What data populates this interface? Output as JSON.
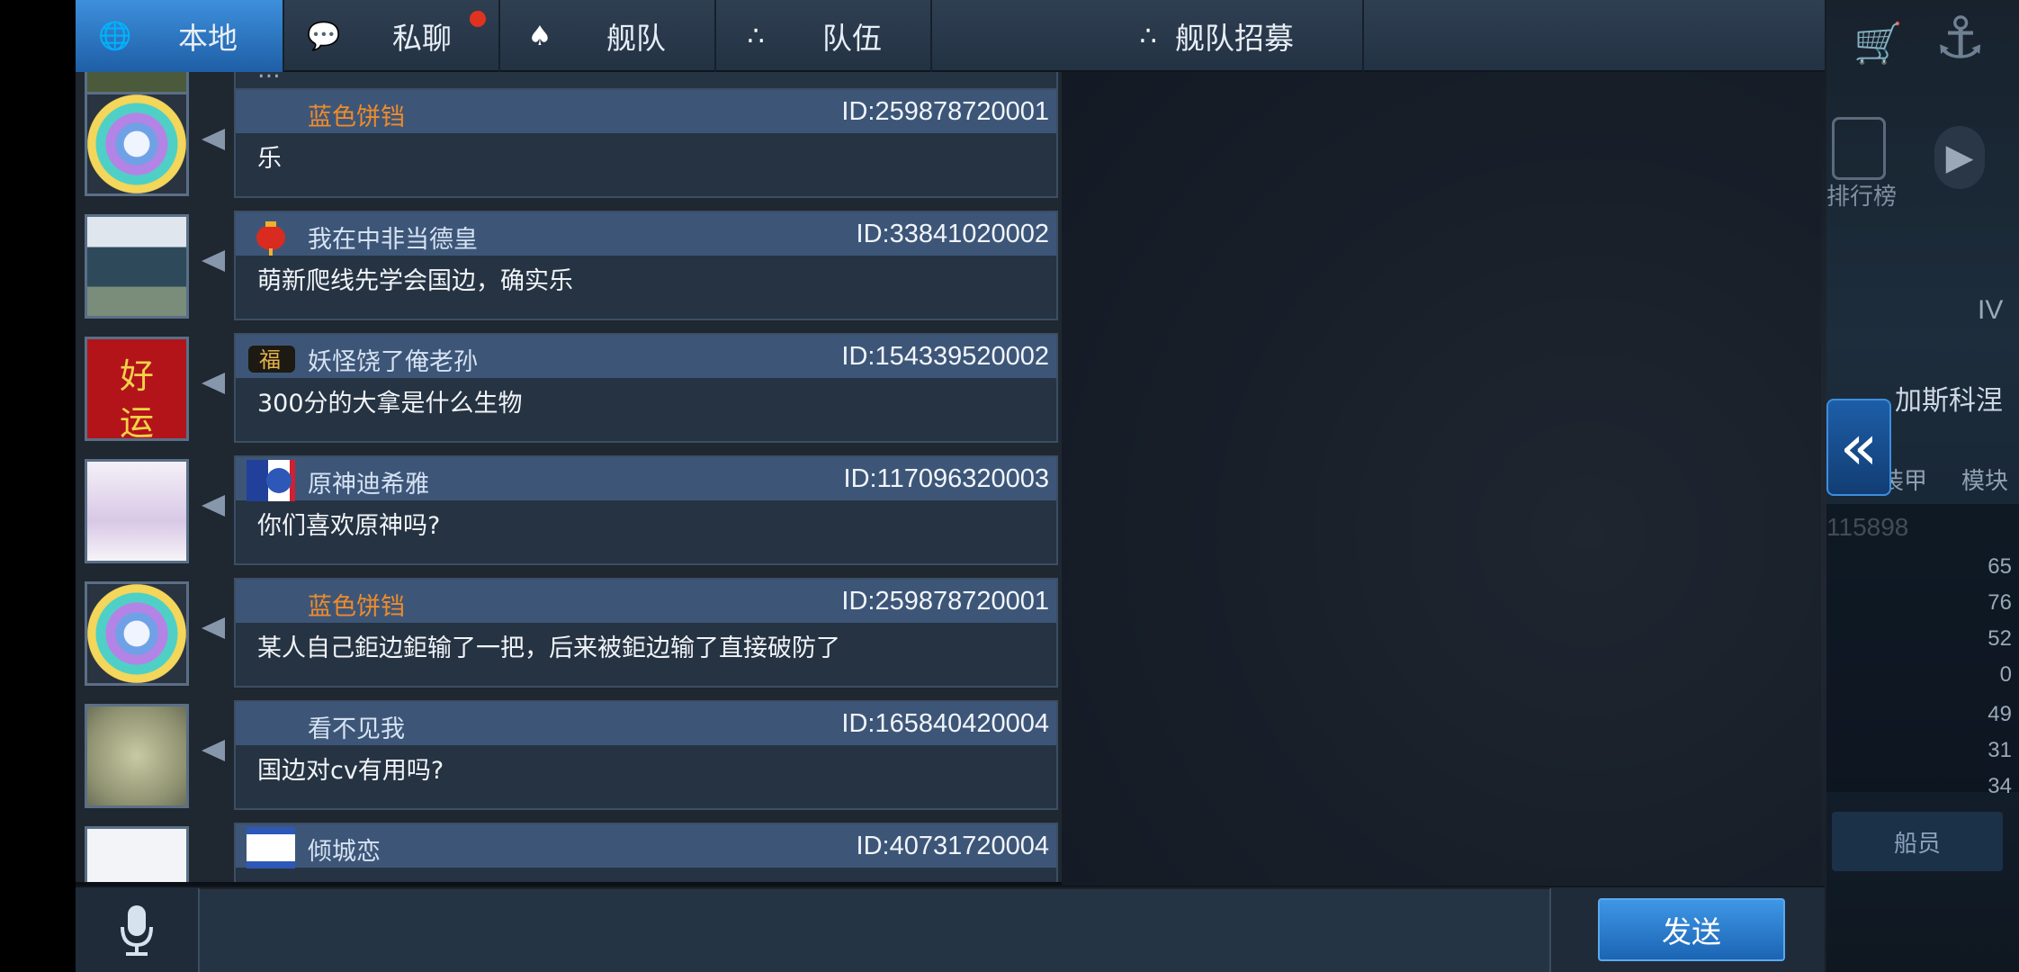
{
  "tabs": [
    {
      "label": "本地",
      "icon": "globe-icon",
      "active": true
    },
    {
      "label": "私聊",
      "icon": "chat-bubble-icon",
      "active": false,
      "badge": true
    },
    {
      "label": "舰队",
      "icon": "fleet-icon",
      "active": false
    },
    {
      "label": "队伍",
      "icon": "team-icon",
      "active": false
    },
    {
      "label": "舰队招募",
      "icon": "recruit-icon",
      "active": false
    }
  ],
  "messages": [
    {
      "name": "蓝色饼铛",
      "name_color": "orange",
      "uid": "ID:259878720001",
      "text": "乐",
      "avatar": "rainbow-badge",
      "badge": ""
    },
    {
      "name": "我在中非当德皇",
      "name_color": "default",
      "uid": "ID:33841020002",
      "text": "萌新爬线先学会国边，确实乐",
      "avatar": "anime-poster",
      "badge": "lantern"
    },
    {
      "name": "妖怪饶了俺老孙",
      "name_color": "default",
      "uid": "ID:154339520002",
      "text": "300分的大拿是什么生物",
      "avatar": "good-luck",
      "badge": "fu"
    },
    {
      "name": "原神迪希雅",
      "name_color": "default",
      "uid": "ID:117096320003",
      "text": "你们喜欢原神吗?",
      "avatar": "anime-girl",
      "badge": "flag"
    },
    {
      "name": "蓝色饼铛",
      "name_color": "orange",
      "uid": "ID:259878720001",
      "text": "某人自己鉅边鉅输了一把，后来被鉅边输了直接破防了",
      "avatar": "rainbow-badge",
      "badge": ""
    },
    {
      "name": "看不见我",
      "name_color": "default",
      "uid": "ID:165840420004",
      "text": "国边对cv有用吗?",
      "avatar": "map-circles",
      "badge": ""
    }
  ],
  "avatar_text": {
    "line1": "好",
    "line2": "运"
  },
  "partial_top_text": "...",
  "partial_bottom": {
    "name": "倾城恋",
    "uid": "ID:40731720004"
  },
  "input": {
    "value": "",
    "placeholder": ""
  },
  "send_label": "发送",
  "side": {
    "ranking_label": "排行榜",
    "tier": "IV",
    "ship_name": "加斯科涅",
    "armor_label": "装甲",
    "module_label": "模块",
    "power": "115898",
    "stats": [
      "65",
      "76",
      "52",
      "0",
      "49",
      "31",
      "34"
    ],
    "crew_label": "船员"
  },
  "colors": {
    "accent": "#3e8fdc",
    "orange_name": "#f08b2a",
    "header": "#3d5678"
  }
}
